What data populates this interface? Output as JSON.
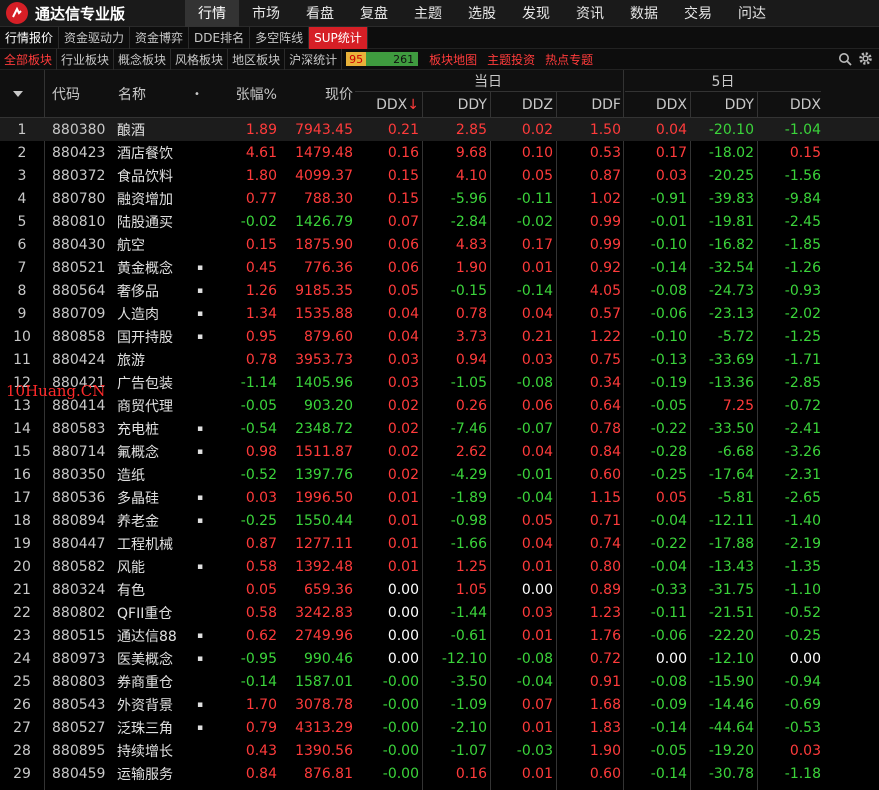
{
  "app": {
    "title": "通达信专业版"
  },
  "main_menu": [
    "行情",
    "市场",
    "看盘",
    "复盘",
    "主题",
    "选股",
    "发现",
    "资讯",
    "数据",
    "交易",
    "问达"
  ],
  "sub_nav": [
    "行情报价",
    "资金驱动力",
    "资金博弈",
    "DDE排名",
    "多空阵线",
    "SUP统计"
  ],
  "board_tabs": [
    "全部板块",
    "行业板块",
    "概念板块",
    "风格板块",
    "地区板块",
    "沪深统计"
  ],
  "ratio": {
    "up": "95",
    "down": "261"
  },
  "extra_tabs": [
    "板块地图",
    "主题投资",
    "热点专题"
  ],
  "header": {
    "code": "代码",
    "name": "名称",
    "name_dot": "•",
    "pct": "张幅%",
    "price": "现价",
    "today": "当日",
    "five_day": "5日",
    "ddx": "DDX",
    "ddx_sort": "↓",
    "ddy": "DDY",
    "ddz": "DDZ",
    "ddf": "DDF",
    "ddx5": "DDX",
    "ddy5": "DDY",
    "ddx5b": "DDX"
  },
  "watermark": "10Huang.CN",
  "rows": [
    {
      "idx": "1",
      "code": "880380",
      "name": "酿酒",
      "dot": "",
      "pct": "1.89",
      "price": "7943.45",
      "ddx": "0.21",
      "ddy": "2.85",
      "ddz": "0.02",
      "ddf": "1.50",
      "ddx5": "0.04",
      "ddy5": "-20.10",
      "ddx5b": "-1.04"
    },
    {
      "idx": "2",
      "code": "880423",
      "name": "酒店餐饮",
      "dot": "",
      "pct": "4.61",
      "price": "1479.48",
      "ddx": "0.16",
      "ddy": "9.68",
      "ddz": "0.10",
      "ddf": "0.53",
      "ddx5": "0.17",
      "ddy5": "-18.02",
      "ddx5b": "0.15"
    },
    {
      "idx": "3",
      "code": "880372",
      "name": "食品饮料",
      "dot": "",
      "pct": "1.80",
      "price": "4099.37",
      "ddx": "0.15",
      "ddy": "4.10",
      "ddz": "0.05",
      "ddf": "0.87",
      "ddx5": "0.03",
      "ddy5": "-20.25",
      "ddx5b": "-1.56"
    },
    {
      "idx": "4",
      "code": "880780",
      "name": "融资增加",
      "dot": "",
      "pct": "0.77",
      "price": "788.30",
      "ddx": "0.15",
      "ddy": "-5.96",
      "ddz": "-0.11",
      "ddf": "1.02",
      "ddx5": "-0.91",
      "ddy5": "-39.83",
      "ddx5b": "-9.84"
    },
    {
      "idx": "5",
      "code": "880810",
      "name": "陆股通买",
      "dot": "",
      "pct": "-0.02",
      "price": "1426.79",
      "ddx": "0.07",
      "ddy": "-2.84",
      "ddz": "-0.02",
      "ddf": "0.99",
      "ddx5": "-0.01",
      "ddy5": "-19.81",
      "ddx5b": "-2.45"
    },
    {
      "idx": "6",
      "code": "880430",
      "name": "航空",
      "dot": "",
      "pct": "0.15",
      "price": "1875.90",
      "ddx": "0.06",
      "ddy": "4.83",
      "ddz": "0.17",
      "ddf": "0.99",
      "ddx5": "-0.10",
      "ddy5": "-16.82",
      "ddx5b": "-1.85"
    },
    {
      "idx": "7",
      "code": "880521",
      "name": "黄金概念",
      "dot": "▪",
      "pct": "0.45",
      "price": "776.36",
      "ddx": "0.06",
      "ddy": "1.90",
      "ddz": "0.01",
      "ddf": "0.92",
      "ddx5": "-0.14",
      "ddy5": "-32.54",
      "ddx5b": "-1.26"
    },
    {
      "idx": "8",
      "code": "880564",
      "name": "奢侈品",
      "dot": "▪",
      "pct": "1.26",
      "price": "9185.35",
      "ddx": "0.05",
      "ddy": "-0.15",
      "ddz": "-0.14",
      "ddf": "4.05",
      "ddx5": "-0.08",
      "ddy5": "-24.73",
      "ddx5b": "-0.93"
    },
    {
      "idx": "9",
      "code": "880709",
      "name": "人造肉",
      "dot": "▪",
      "pct": "1.34",
      "price": "1535.88",
      "ddx": "0.04",
      "ddy": "0.78",
      "ddz": "0.04",
      "ddf": "0.57",
      "ddx5": "-0.06",
      "ddy5": "-23.13",
      "ddx5b": "-2.02"
    },
    {
      "idx": "10",
      "code": "880858",
      "name": "国开持股",
      "dot": "▪",
      "pct": "0.95",
      "price": "879.60",
      "ddx": "0.04",
      "ddy": "3.73",
      "ddz": "0.21",
      "ddf": "1.22",
      "ddx5": "-0.10",
      "ddy5": "-5.72",
      "ddx5b": "-1.25"
    },
    {
      "idx": "11",
      "code": "880424",
      "name": "旅游",
      "dot": "",
      "pct": "0.78",
      "price": "3953.73",
      "ddx": "0.03",
      "ddy": "0.94",
      "ddz": "0.03",
      "ddf": "0.75",
      "ddx5": "-0.13",
      "ddy5": "-33.69",
      "ddx5b": "-1.71"
    },
    {
      "idx": "12",
      "code": "880421",
      "name": "广告包装",
      "dot": "",
      "pct": "-1.14",
      "price": "1405.96",
      "ddx": "0.03",
      "ddy": "-1.05",
      "ddz": "-0.08",
      "ddf": "0.34",
      "ddx5": "-0.19",
      "ddy5": "-13.36",
      "ddx5b": "-2.85"
    },
    {
      "idx": "13",
      "code": "880414",
      "name": "商贸代理",
      "dot": "",
      "pct": "-0.05",
      "price": "903.20",
      "ddx": "0.02",
      "ddy": "0.26",
      "ddz": "0.06",
      "ddf": "0.64",
      "ddx5": "-0.05",
      "ddy5": "7.25",
      "ddx5b": "-0.72"
    },
    {
      "idx": "14",
      "code": "880583",
      "name": "充电桩",
      "dot": "▪",
      "pct": "-0.54",
      "price": "2348.72",
      "ddx": "0.02",
      "ddy": "-7.46",
      "ddz": "-0.07",
      "ddf": "0.78",
      "ddx5": "-0.22",
      "ddy5": "-33.50",
      "ddx5b": "-2.41"
    },
    {
      "idx": "15",
      "code": "880714",
      "name": "氟概念",
      "dot": "▪",
      "pct": "0.98",
      "price": "1511.87",
      "ddx": "0.02",
      "ddy": "2.62",
      "ddz": "0.04",
      "ddf": "0.84",
      "ddx5": "-0.28",
      "ddy5": "-6.68",
      "ddx5b": "-3.26"
    },
    {
      "idx": "16",
      "code": "880350",
      "name": "造纸",
      "dot": "",
      "pct": "-0.52",
      "price": "1397.76",
      "ddx": "0.02",
      "ddy": "-4.29",
      "ddz": "-0.01",
      "ddf": "0.60",
      "ddx5": "-0.25",
      "ddy5": "-17.64",
      "ddx5b": "-2.31"
    },
    {
      "idx": "17",
      "code": "880536",
      "name": "多晶硅",
      "dot": "▪",
      "pct": "0.03",
      "price": "1996.50",
      "ddx": "0.01",
      "ddy": "-1.89",
      "ddz": "-0.04",
      "ddf": "1.15",
      "ddx5": "0.05",
      "ddy5": "-5.81",
      "ddx5b": "-2.65"
    },
    {
      "idx": "18",
      "code": "880894",
      "name": "养老金",
      "dot": "▪",
      "pct": "-0.25",
      "price": "1550.44",
      "ddx": "0.01",
      "ddy": "-0.98",
      "ddz": "0.05",
      "ddf": "0.71",
      "ddx5": "-0.04",
      "ddy5": "-12.11",
      "ddx5b": "-1.40"
    },
    {
      "idx": "19",
      "code": "880447",
      "name": "工程机械",
      "dot": "",
      "pct": "0.87",
      "price": "1277.11",
      "ddx": "0.01",
      "ddy": "-1.66",
      "ddz": "0.04",
      "ddf": "0.74",
      "ddx5": "-0.22",
      "ddy5": "-17.88",
      "ddx5b": "-2.19"
    },
    {
      "idx": "20",
      "code": "880582",
      "name": "风能",
      "dot": "▪",
      "pct": "0.58",
      "price": "1392.48",
      "ddx": "0.01",
      "ddy": "1.25",
      "ddz": "0.01",
      "ddf": "0.80",
      "ddx5": "-0.04",
      "ddy5": "-13.43",
      "ddx5b": "-1.35"
    },
    {
      "idx": "21",
      "code": "880324",
      "name": "有色",
      "dot": "",
      "pct": "0.05",
      "price": "659.36",
      "ddx": "0.00",
      "ddy": "1.05",
      "ddz": "0.00",
      "ddf": "0.89",
      "ddx5": "-0.33",
      "ddy5": "-31.75",
      "ddx5b": "-1.10"
    },
    {
      "idx": "22",
      "code": "880802",
      "name": "QFII重仓",
      "dot": "",
      "pct": "0.58",
      "price": "3242.83",
      "ddx": "0.00",
      "ddy": "-1.44",
      "ddz": "0.03",
      "ddf": "1.23",
      "ddx5": "-0.11",
      "ddy5": "-21.51",
      "ddx5b": "-0.52"
    },
    {
      "idx": "23",
      "code": "880515",
      "name": "通达信88",
      "dot": "▪",
      "pct": "0.62",
      "price": "2749.96",
      "ddx": "0.00",
      "ddy": "-0.61",
      "ddz": "0.01",
      "ddf": "1.76",
      "ddx5": "-0.06",
      "ddy5": "-22.20",
      "ddx5b": "-0.25"
    },
    {
      "idx": "24",
      "code": "880973",
      "name": "医美概念",
      "dot": "▪",
      "pct": "-0.95",
      "price": "990.46",
      "ddx": "0.00",
      "ddy": "-12.10",
      "ddz": "-0.08",
      "ddf": "0.72",
      "ddx5": "0.00",
      "ddy5": "-12.10",
      "ddx5b": "0.00"
    },
    {
      "idx": "25",
      "code": "880803",
      "name": "券商重仓",
      "dot": "",
      "pct": "-0.14",
      "price": "1587.01",
      "ddx": "-0.00",
      "ddy": "-3.50",
      "ddz": "-0.04",
      "ddf": "0.91",
      "ddx5": "-0.08",
      "ddy5": "-15.90",
      "ddx5b": "-0.94"
    },
    {
      "idx": "26",
      "code": "880543",
      "name": "外资背景",
      "dot": "▪",
      "pct": "1.70",
      "price": "3078.78",
      "ddx": "-0.00",
      "ddy": "-1.09",
      "ddz": "0.07",
      "ddf": "1.68",
      "ddx5": "-0.09",
      "ddy5": "-14.46",
      "ddx5b": "-0.69"
    },
    {
      "idx": "27",
      "code": "880527",
      "name": "泛珠三角",
      "dot": "▪",
      "pct": "0.79",
      "price": "4313.29",
      "ddx": "-0.00",
      "ddy": "-2.10",
      "ddz": "0.01",
      "ddf": "1.83",
      "ddx5": "-0.14",
      "ddy5": "-44.64",
      "ddx5b": "-0.53"
    },
    {
      "idx": "28",
      "code": "880895",
      "name": "持续增长",
      "dot": "",
      "pct": "0.43",
      "price": "1390.56",
      "ddx": "-0.00",
      "ddy": "-1.07",
      "ddz": "-0.03",
      "ddf": "1.90",
      "ddx5": "-0.05",
      "ddy5": "-19.20",
      "ddx5b": "0.03"
    },
    {
      "idx": "29",
      "code": "880459",
      "name": "运输服务",
      "dot": "",
      "pct": "0.84",
      "price": "876.81",
      "ddx": "-0.00",
      "ddy": "0.16",
      "ddz": "0.01",
      "ddf": "0.60",
      "ddx5": "-0.14",
      "ddy5": "-30.78",
      "ddx5b": "-1.18"
    }
  ]
}
